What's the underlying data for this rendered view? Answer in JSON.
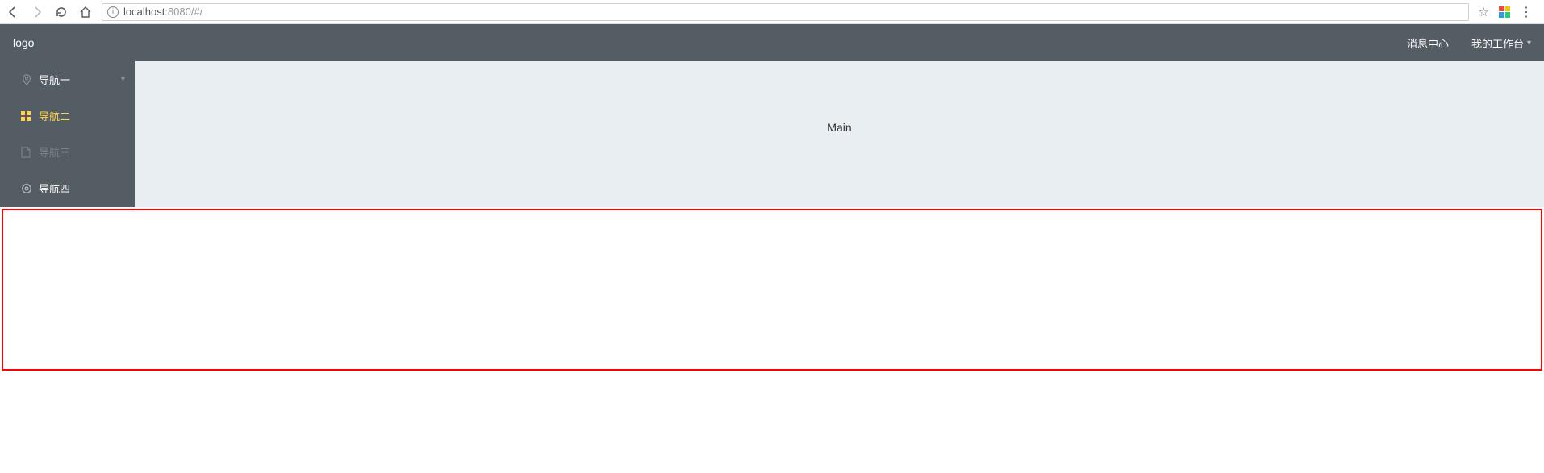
{
  "browser": {
    "url_host": "localhost:",
    "url_port_path": "8080/#/"
  },
  "header": {
    "logo": "logo",
    "menu": {
      "message_center": "消息中心",
      "workspace": "我的工作台"
    }
  },
  "sidebar": {
    "items": [
      {
        "label": "导航一",
        "icon": "location",
        "expandable": true
      },
      {
        "label": "导航二",
        "icon": "grid",
        "active": true
      },
      {
        "label": "导航三",
        "icon": "document",
        "disabled": true
      },
      {
        "label": "导航四",
        "icon": "setting"
      }
    ]
  },
  "main": {
    "text": "Main"
  }
}
